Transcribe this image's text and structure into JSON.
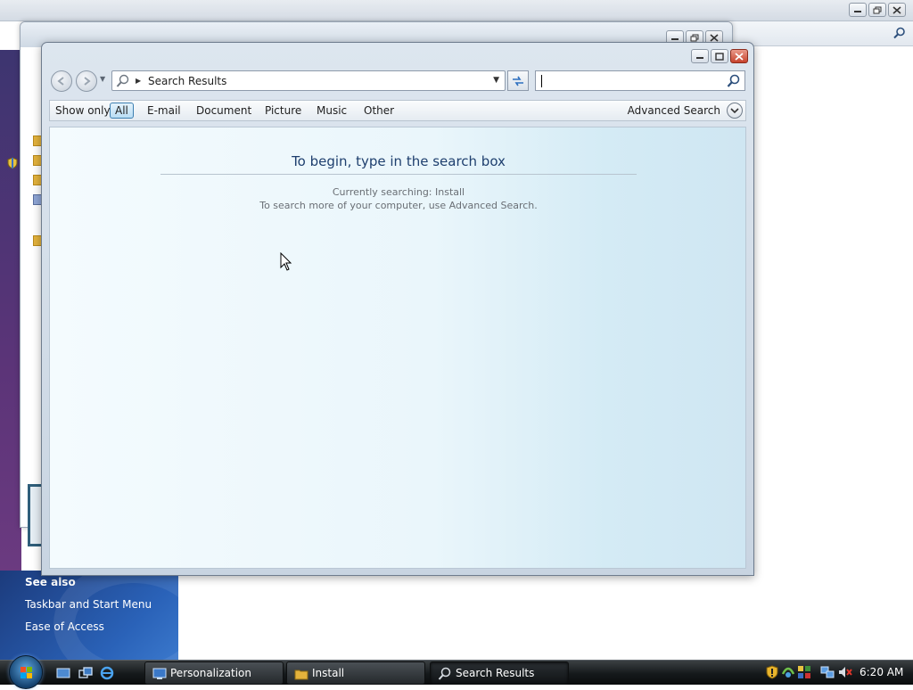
{
  "search_window": {
    "address": {
      "location": "Search Results"
    },
    "filter_bar": {
      "label": "Show only:",
      "filters": [
        "All",
        "E-mail",
        "Document",
        "Picture",
        "Music",
        "Other"
      ],
      "advanced_search": "Advanced Search"
    },
    "content": {
      "heading": "To begin, type in the search box",
      "line1": "Currently searching: Install",
      "line2": "To search more of your computer, use Advanced Search."
    }
  },
  "see_also": {
    "title": "See also",
    "links": [
      "Taskbar and Start Menu",
      "Ease of Access"
    ]
  },
  "taskbar": {
    "buttons": [
      {
        "label": "Personalization",
        "icon": "personalization-icon"
      },
      {
        "label": "Install",
        "icon": "folder-icon"
      },
      {
        "label": "Search Results",
        "icon": "search-icon"
      }
    ],
    "clock": "6:20 AM"
  },
  "colors": {
    "accent": "#1e3f6e",
    "filter_selected": "#b9ddf4",
    "close_button": "#c7432d"
  }
}
